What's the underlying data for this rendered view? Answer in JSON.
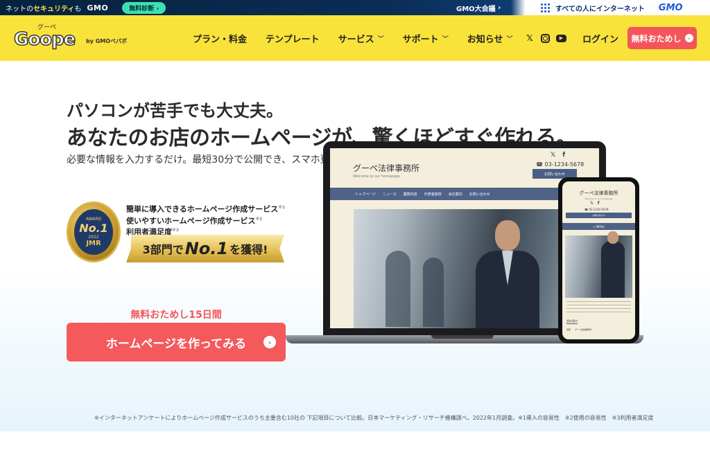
{
  "topbar": {
    "security_prefix": "ネットの",
    "security_highlight": "セキュリティ",
    "security_suffix": "も",
    "gmo_logo": "GMO",
    "diagnosis_button": "無料診断",
    "conference_link": "GMO大会議",
    "slogan": "すべての人にインターネット",
    "gmo_logo_right": "GMO"
  },
  "header": {
    "logo_wordmark": "Goope",
    "logo_kana": "グーペ",
    "logo_by": "by GMOペパボ",
    "nav": [
      {
        "label": "プラン・料金",
        "chevron": false
      },
      {
        "label": "テンプレート",
        "chevron": false
      },
      {
        "label": "サービス",
        "chevron": true
      },
      {
        "label": "サポート",
        "chevron": true
      },
      {
        "label": "お知らせ",
        "chevron": true
      }
    ],
    "social": [
      "x-icon",
      "instagram-icon",
      "youtube-icon"
    ],
    "login": "ログイン",
    "trial_button": "無料おためし"
  },
  "hero": {
    "subheading": "パソコンが苦手でも大丈夫。",
    "heading": "あなたのお店のホームページが、驚くほどすぐ作れる。",
    "description": "必要な情報を入力するだけ。最短30分で公開でき、スマホ更新ももちろん簡単です。",
    "award": {
      "medal_award": "AWARD",
      "medal_no1": "No.1",
      "medal_year": "2022",
      "medal_org": "JMR",
      "items": [
        {
          "text": "簡単に導入できるホームページ作成サービス",
          "note": "※1"
        },
        {
          "text": "使いやすいホームページ作成サービス",
          "note": "※2"
        },
        {
          "text": "利用者満足度",
          "note": "※3"
        }
      ],
      "ribbon_prefix": "3部門で",
      "ribbon_big": "No.1",
      "ribbon_suffix": "を獲得!"
    },
    "trial_label": "無料おためし15日間",
    "cta_button": "ホームページを作ってみる"
  },
  "mockup": {
    "site_title": "グーペ法律事務所",
    "site_welcome": "Welcome to our homepage",
    "site_phone": "03-1234-5678",
    "site_contact": "お問い合わせ",
    "site_nav": [
      "トップページ",
      "ニュース",
      "業務内容",
      "代表者挨拶",
      "会社案内",
      "お問い合わせ"
    ],
    "phone_menu": "MENU",
    "phone_company": "会社案内",
    "phone_row": "名称　　グーペ法律事務所"
  },
  "footnote": "※インターネットアンケートによりホームページ作成サービスのうち主要含む10社の 下記項目について比較。日本マーケティング・リサーチ機構調べ。2022年1月調査。※1導入の容易性　※2使用の容易性　※3利用者満足度",
  "colors": {
    "header_bg": "#f9e23a",
    "cta": "#f4595c",
    "trial_label": "#f35656",
    "site_nav": "#4f6288"
  }
}
